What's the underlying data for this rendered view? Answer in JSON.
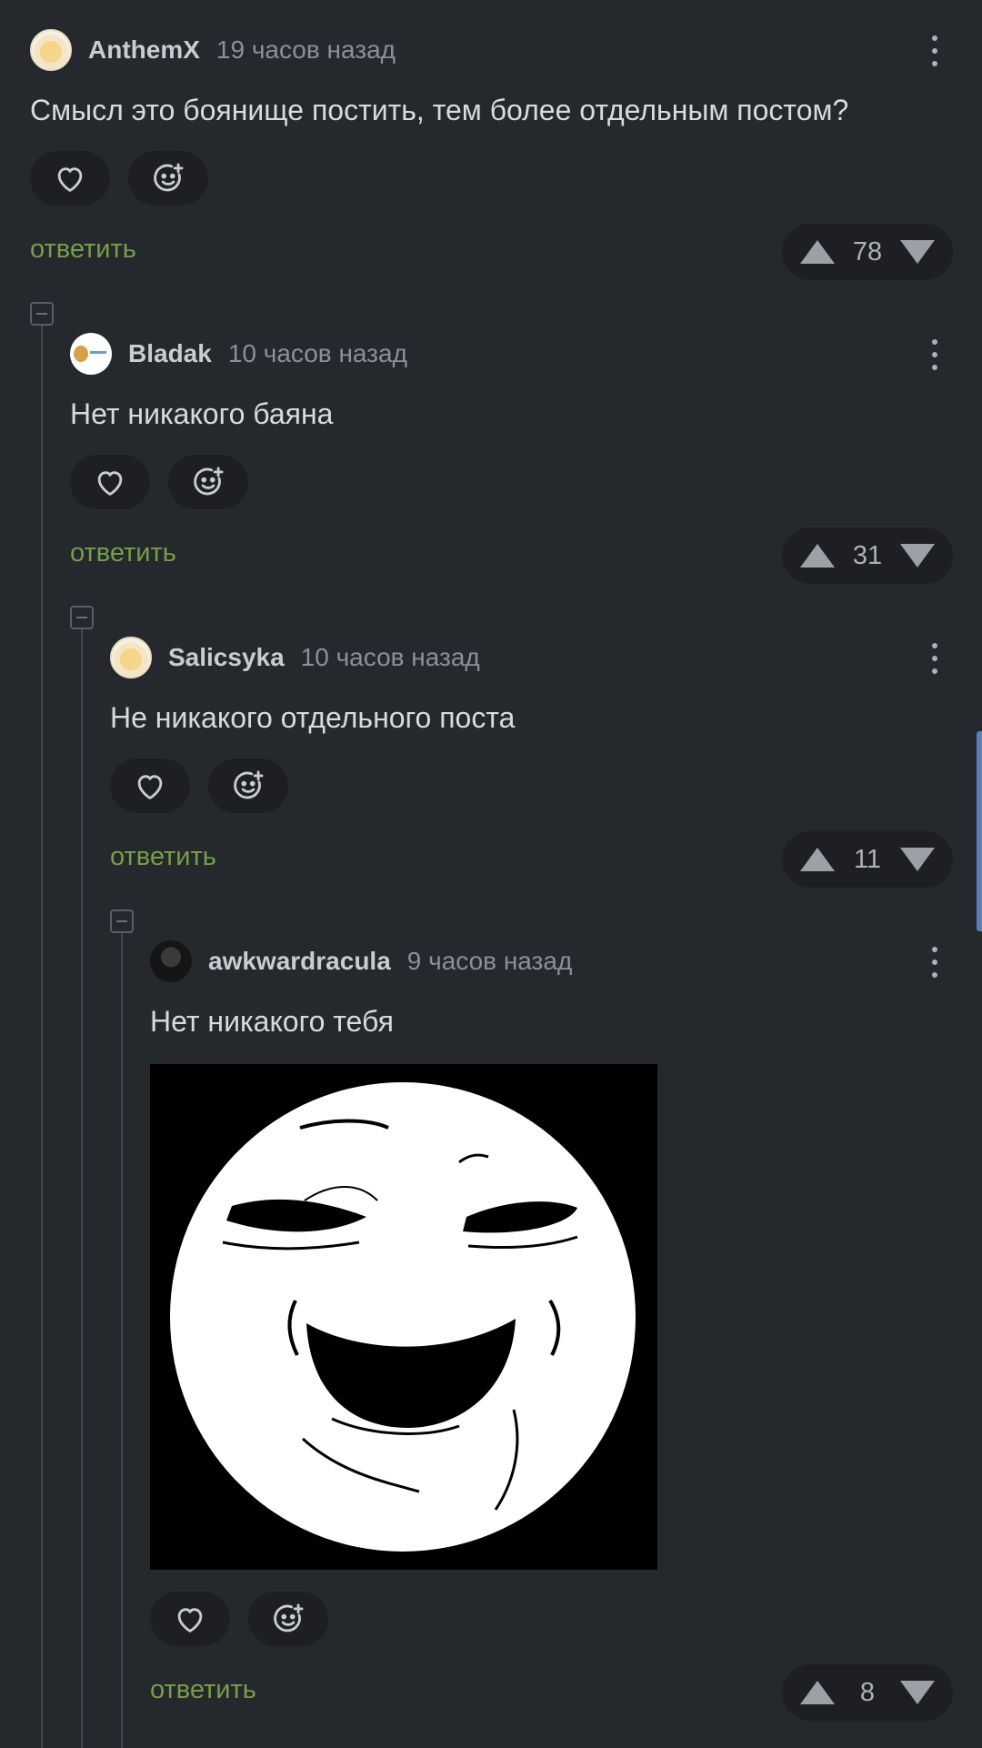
{
  "comments": [
    {
      "username": "AnthemX",
      "timestamp": "19 часов назад",
      "text": "Смысл это боянище постить, тем более отдельным постом?",
      "reply_label": "ответить",
      "score": "78"
    },
    {
      "username": "Bladak",
      "timestamp": "10 часов назад",
      "text": "Нет никакого баяна",
      "reply_label": "ответить",
      "score": "31"
    },
    {
      "username": "Salicsyka",
      "timestamp": "10 часов назад",
      "text": "Не никакого отдельного поста",
      "reply_label": "ответить",
      "score": "11"
    },
    {
      "username": "awkwardracula",
      "timestamp": "9 часов назад",
      "text": "Нет никакого тебя",
      "reply_label": "ответить",
      "score": "8"
    }
  ],
  "colors": {
    "background": "#25282d",
    "pill": "#1d1f23",
    "reply_link": "#74a046",
    "scroll_indicator": "#5b7fb7"
  },
  "icons": [
    "heart-icon",
    "add-reaction-icon",
    "more-vertical-icon",
    "upvote-icon",
    "downvote-icon",
    "collapse-icon"
  ]
}
